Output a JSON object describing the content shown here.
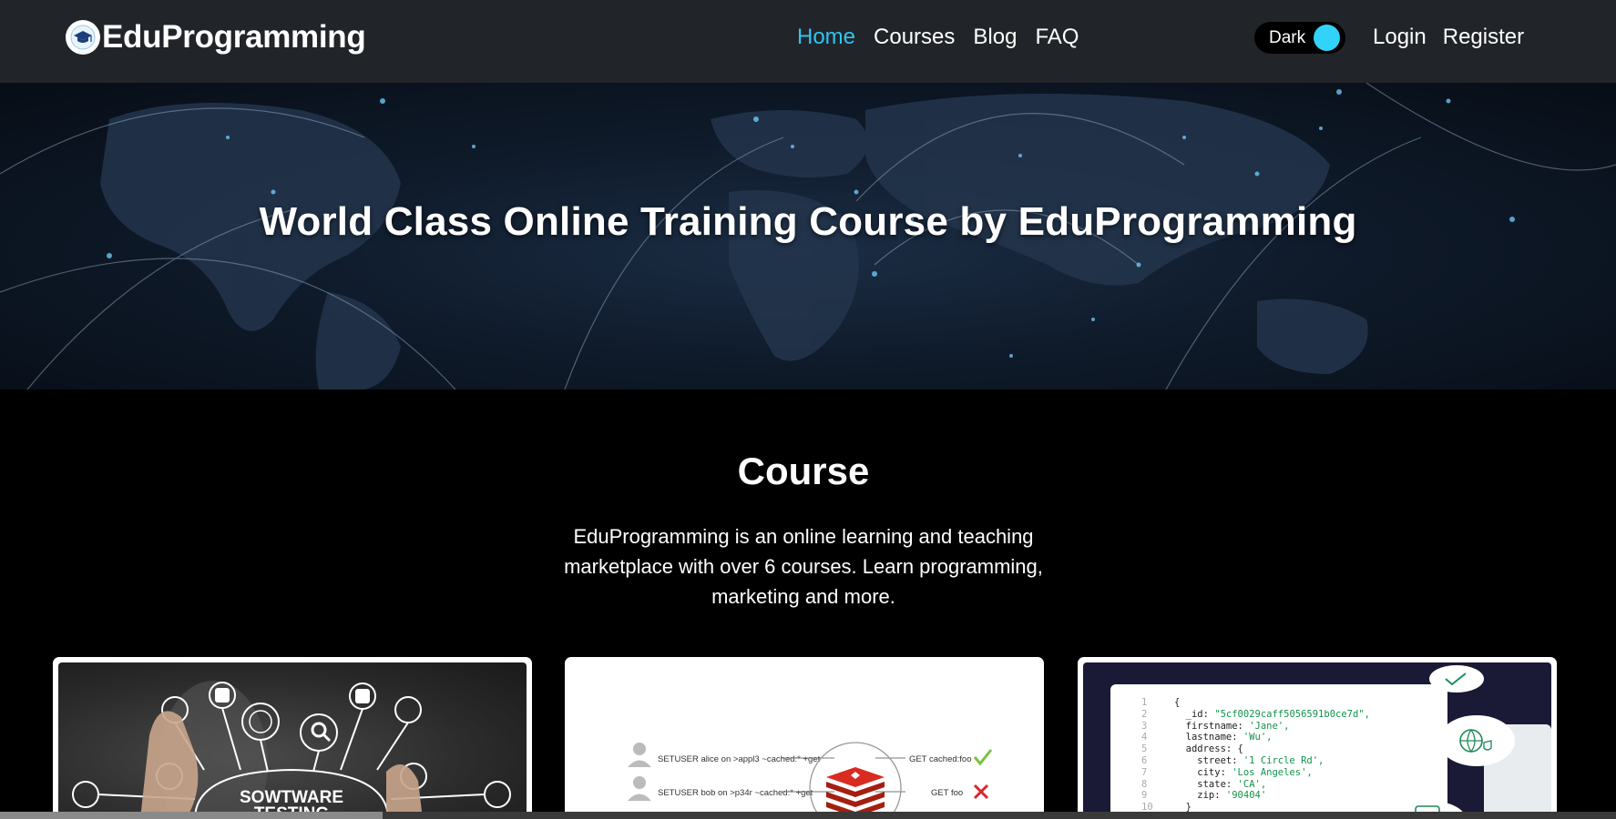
{
  "brand": {
    "name": "EduProgramming",
    "logo_icon": "graduation-cap-icon"
  },
  "nav": {
    "items": [
      {
        "label": "Home",
        "active": true
      },
      {
        "label": "Courses",
        "active": false
      },
      {
        "label": "Blog",
        "active": false
      },
      {
        "label": "FAQ",
        "active": false
      }
    ]
  },
  "theme_toggle": {
    "label": "Dark",
    "knob_color": "#31d4f8"
  },
  "auth": {
    "login": "Login",
    "register": "Register"
  },
  "hero": {
    "title": "World Class Online Training Course by EduProgramming"
  },
  "course_section": {
    "title": "Course",
    "description": "EduProgramming is an online learning and teaching marketplace with over 6 courses. Learn programming, marketing and more."
  },
  "cards": [
    {
      "image_text_line1": "SOWTWARE",
      "image_text_line2": "TESTING"
    },
    {
      "rows": [
        {
          "left": "SETUSER alice on >appl3 ~cached:* +get",
          "right": "GET cached:foo"
        },
        {
          "left": "SETUSER bob on >p34r ~cached:* +get",
          "right": "GET foo"
        }
      ]
    },
    {
      "code": [
        {
          "n": "1",
          "text": "{"
        },
        {
          "n": "2",
          "key": "  _id: ",
          "val": "\"5cf0029caff5056591b0ce7d\","
        },
        {
          "n": "3",
          "key": "  firstname: ",
          "val": "'Jane',"
        },
        {
          "n": "4",
          "key": "  lastname: ",
          "val": "'Wu',"
        },
        {
          "n": "5",
          "key": "  address: {",
          "val": ""
        },
        {
          "n": "6",
          "key": "    street: ",
          "val": "'1 Circle Rd',"
        },
        {
          "n": "7",
          "key": "    city: ",
          "val": "'Los Angeles',"
        },
        {
          "n": "8",
          "key": "    state: ",
          "val": "'CA',"
        },
        {
          "n": "9",
          "key": "    zip: ",
          "val": "'90404'"
        },
        {
          "n": "10",
          "text": "  }"
        }
      ]
    }
  ],
  "colors": {
    "accent": "#31c4f2",
    "navbar": "#212529",
    "page": "#000000"
  }
}
